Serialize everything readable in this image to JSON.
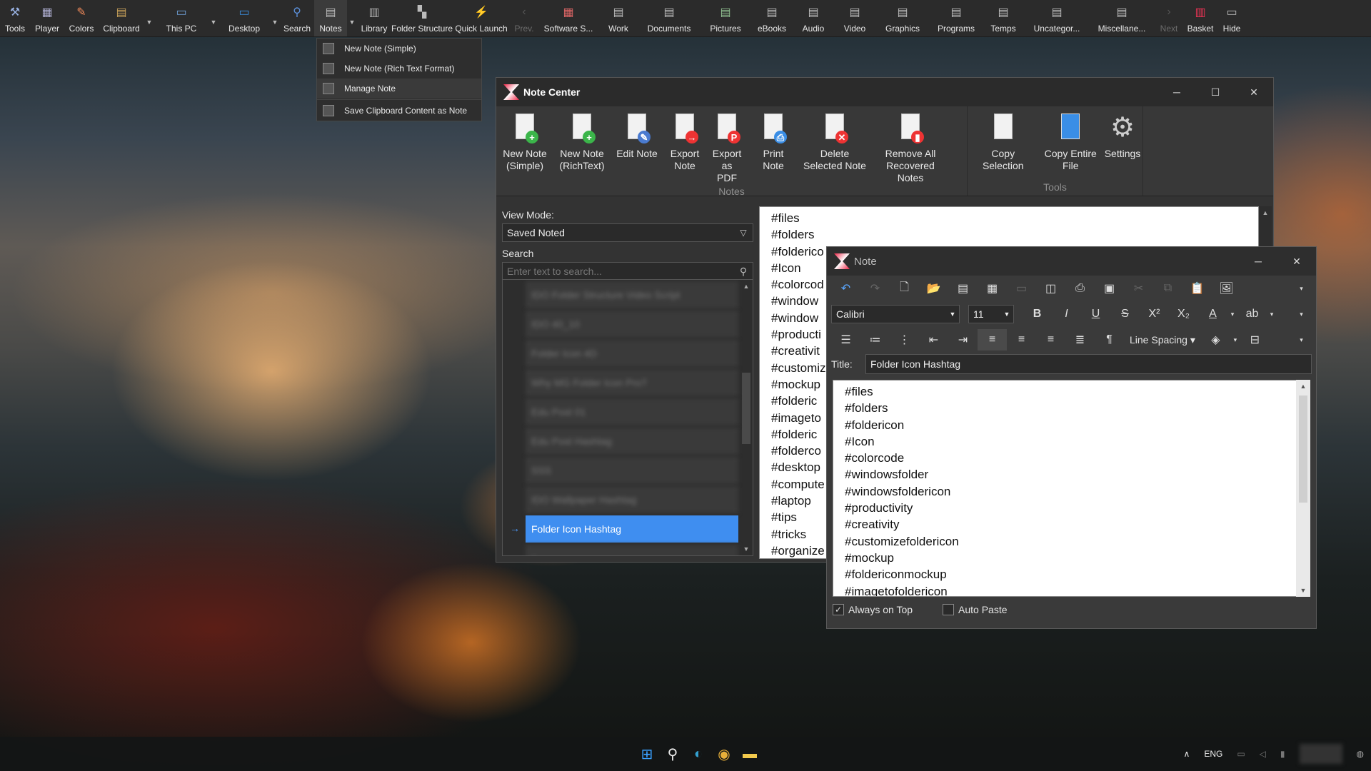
{
  "toolbar": {
    "items": [
      {
        "label": "Tools",
        "icon": "tools-icon"
      },
      {
        "label": "Player",
        "icon": "player-icon"
      },
      {
        "label": "Colors",
        "icon": "colors-icon"
      },
      {
        "label": "Clipboard",
        "icon": "clipboard-icon"
      },
      {
        "label": "This PC",
        "icon": "this-pc-icon"
      },
      {
        "label": "Desktop",
        "icon": "desktop-icon"
      },
      {
        "label": "Search",
        "icon": "search-icon"
      },
      {
        "label": "Notes",
        "icon": "notes-icon"
      },
      {
        "label": "Library",
        "icon": "library-icon"
      },
      {
        "label": "Folder Structure",
        "icon": "folder-structure-icon"
      },
      {
        "label": "Quick Launch",
        "icon": "lightning-icon"
      },
      {
        "label": "Prev.",
        "icon": "prev-icon"
      },
      {
        "label": "Software S...",
        "icon": "software-folder-icon"
      },
      {
        "label": "Work",
        "icon": "work-folder-icon"
      },
      {
        "label": "Documents",
        "icon": "documents-folder-icon"
      },
      {
        "label": "Pictures",
        "icon": "pictures-folder-icon"
      },
      {
        "label": "eBooks",
        "icon": "ebooks-folder-icon"
      },
      {
        "label": "Audio",
        "icon": "audio-folder-icon"
      },
      {
        "label": "Video",
        "icon": "video-folder-icon"
      },
      {
        "label": "Graphics",
        "icon": "graphics-folder-icon"
      },
      {
        "label": "Programs",
        "icon": "programs-folder-icon"
      },
      {
        "label": "Temps",
        "icon": "temps-folder-icon"
      },
      {
        "label": "Uncategor...",
        "icon": "uncategorized-folder-icon"
      },
      {
        "label": "Miscellane...",
        "icon": "miscellaneous-folder-icon"
      },
      {
        "label": "Next",
        "icon": "next-icon"
      },
      {
        "label": "Basket",
        "icon": "basket-icon"
      },
      {
        "label": "Hide",
        "icon": "hide-icon"
      }
    ]
  },
  "notes_menu": {
    "items": [
      "New Note (Simple)",
      "New Note (Rich Text Format)",
      "Manage Note",
      "Save Clipboard Content as Note"
    ]
  },
  "note_center": {
    "title": "Note Center",
    "controls": {
      "minimize": "─",
      "maximize": "☐",
      "close": "✕"
    },
    "ribbon": {
      "notes_group": {
        "label": "Notes",
        "buttons": [
          {
            "line1": "New Note",
            "line2": "(Simple)"
          },
          {
            "line1": "New Note",
            "line2": "(RichText)"
          },
          {
            "line1": "Edit Note",
            "line2": ""
          },
          {
            "line1": "Export",
            "line2": "Note"
          },
          {
            "line1": "Export",
            "line2": "as PDF"
          },
          {
            "line1": "Print",
            "line2": "Note"
          },
          {
            "line1": "Delete",
            "line2": "Selected Note"
          },
          {
            "line1": "Remove All",
            "line2": "Recovered Notes"
          }
        ]
      },
      "tools_group": {
        "label": "Tools",
        "buttons": [
          {
            "line1": "Copy Selection",
            "line2": ""
          },
          {
            "line1": "Copy Entire",
            "line2": "File"
          },
          {
            "line1": "Settings",
            "line2": ""
          }
        ]
      }
    },
    "view_mode_label": "View Mode:",
    "view_mode_value": "Saved Noted",
    "search_label": "Search",
    "search_placeholder": "Enter text to search...",
    "list": [
      "IDO Folder Structure Video Script",
      "IDO 40_10",
      "Folder Icon 4D",
      "Why MG Folder Icon Pro?",
      "Edu Post 01",
      "Edu Post Hashtag",
      "SSS",
      "IDO Wallpaper Hashtag",
      "Folder Icon Hashtag",
      "c..."
    ],
    "selected_note": "Folder Icon Hashtag",
    "content_lines": [
      "#files",
      "#folders",
      "#folderico",
      "#Icon",
      "#colorcod",
      "#window",
      "#window",
      "#producti",
      "#creativit",
      "#customiz",
      "#mockup",
      "#folderic",
      "#imageto",
      "#folderic",
      "#folderco",
      "#desktop",
      "#compute",
      "#laptop",
      "#tips",
      "#tricks",
      "#organize"
    ]
  },
  "note_window": {
    "title": "Note",
    "controls": {
      "minimize": "─",
      "close": "✕"
    },
    "font_name": "Calibri",
    "font_size": "11",
    "line_spacing_label": "Line Spacing",
    "title_label": "Title:",
    "title_value": "Folder Icon Hashtag",
    "lines": [
      "#files",
      "#folders",
      "#foldericon",
      "#Icon",
      "#colorcode",
      "#windowsfolder",
      "#windowsfoldericon",
      "#productivity",
      "#creativity",
      "#customizefoldericon",
      "#mockup",
      "#foldericonmockup",
      "#imagetofoldericon"
    ],
    "always_on_top_label": "Always on Top",
    "always_on_top_checked": "✓",
    "auto_paste_label": "Auto Paste"
  },
  "taskbar": {
    "tray_lang": "ENG"
  }
}
